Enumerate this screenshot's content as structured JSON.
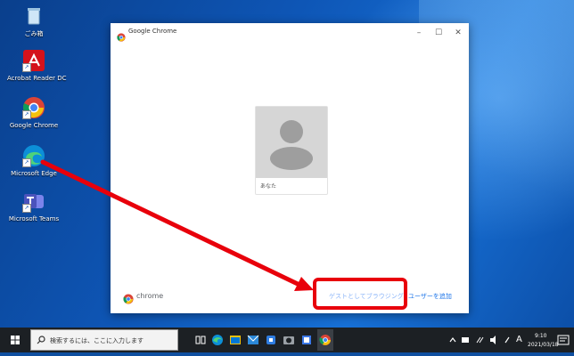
{
  "desktop": {
    "icons": [
      {
        "label": "ごみ箱",
        "icon": "recycle-bin-icon"
      },
      {
        "label": "Acrobat Reader DC",
        "icon": "acrobat-reader-icon"
      },
      {
        "label": "Google Chrome",
        "icon": "chrome-icon"
      },
      {
        "label": "Microsoft Edge",
        "icon": "edge-icon"
      },
      {
        "label": "Microsoft Teams",
        "icon": "teams-icon"
      }
    ]
  },
  "window": {
    "title": "Google Chrome",
    "controls": {
      "minimize": "–",
      "maximize": "☐",
      "close": "✕"
    },
    "profile": {
      "name": "あなた"
    },
    "footer": {
      "brand": "chrome",
      "guest_label": "ゲストとしてブラウジング",
      "add_user_label": "ユーザーを追加"
    }
  },
  "taskbar": {
    "search_placeholder": "検索するには、ここに入力します",
    "apps": [
      "task-view-icon",
      "edge-icon",
      "store-icon",
      "mail-icon",
      "teams-icon",
      "camera-icon",
      "app-icon",
      "chrome-icon"
    ],
    "tray": {
      "time": "9:10",
      "date": "2021/03/18",
      "ime": "A"
    }
  },
  "colors": {
    "highlight": "#e8000b",
    "accent": "#1a73e8",
    "taskbar": "#1c2024"
  }
}
